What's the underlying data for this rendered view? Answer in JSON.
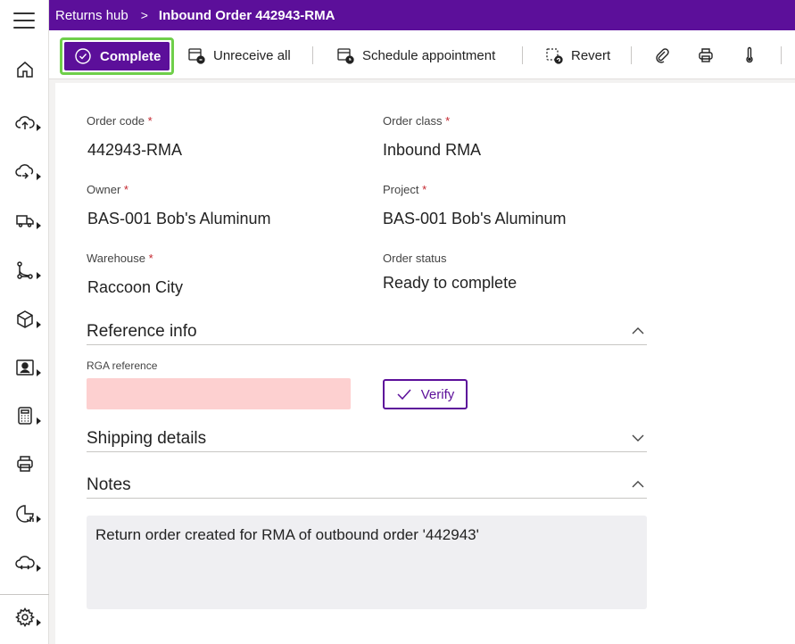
{
  "breadcrumb": {
    "parent": "Returns hub",
    "separator": ">",
    "current": "Inbound Order 442943-RMA"
  },
  "toolbar": {
    "complete_label": "Complete",
    "unreceive_label": "Unreceive all",
    "schedule_label": "Schedule appointment",
    "revert_label": "Revert",
    "icons": [
      "attach-icon",
      "print-icon",
      "thermometer-icon"
    ]
  },
  "form": {
    "order_code": {
      "label": "Order code",
      "required": "*",
      "value": "442943-RMA"
    },
    "order_class": {
      "label": "Order class",
      "required": "*",
      "value": "Inbound RMA"
    },
    "owner": {
      "label": "Owner",
      "required": "*",
      "value": "BAS-001 Bob's Aluminum"
    },
    "project": {
      "label": "Project",
      "required": "*",
      "value": "BAS-001 Bob's Aluminum"
    },
    "warehouse": {
      "label": "Warehouse",
      "required": "*",
      "value": "Raccoon City"
    },
    "order_status": {
      "label": "Order status",
      "value": "Ready to complete"
    }
  },
  "sections": {
    "reference": {
      "title": "Reference info",
      "expanded": true
    },
    "shipping": {
      "title": "Shipping details",
      "expanded": false
    },
    "notes": {
      "title": "Notes",
      "expanded": true
    }
  },
  "reference": {
    "rga_label": "RGA reference",
    "rga_value": "",
    "verify_label": "Verify"
  },
  "notes": {
    "text": "Return order created for RMA of outbound order '442943'"
  },
  "colors": {
    "brand": "#5c0f9a",
    "highlight": "#6fcf4a",
    "invalid": "#fdd0d0"
  }
}
